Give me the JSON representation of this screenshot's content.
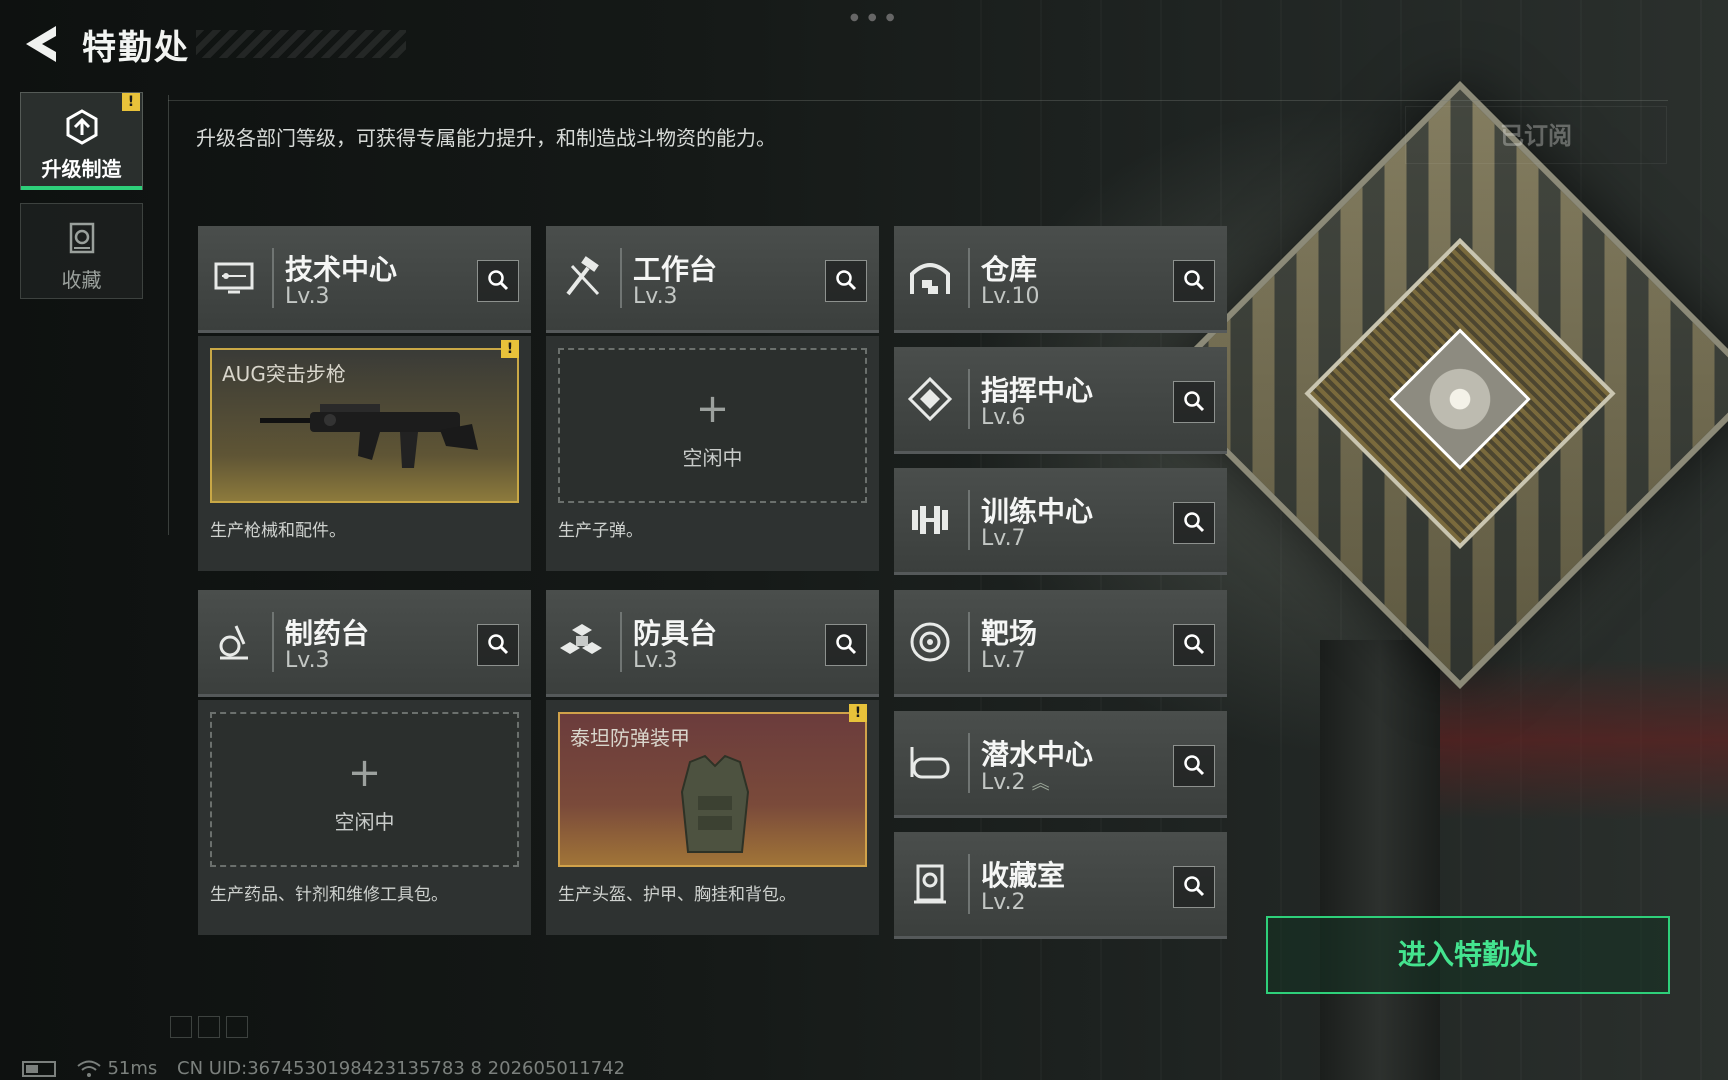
{
  "header": {
    "title": "特勤处",
    "back_icon": "back-arrow-icon"
  },
  "nav": {
    "items": [
      {
        "label": "升级制造",
        "icon": "upgrade-icon",
        "active": true,
        "warning": "!"
      },
      {
        "label": "收藏",
        "icon": "collection-icon",
        "active": false
      }
    ]
  },
  "description": "升级各部门等级，可获得专属能力提升，和制造战斗物资的能力。",
  "subscribe_label": "已订阅",
  "facilities": [
    {
      "name": "技术中心",
      "level": "Lv.3",
      "icon": "tech-center-icon",
      "production": {
        "state": "active",
        "item": "AUG突击步枪",
        "warning": "!"
      },
      "desc": "生产枪械和配件。"
    },
    {
      "name": "工作台",
      "level": "Lv.3",
      "icon": "workbench-icon",
      "production": {
        "state": "idle",
        "idle_label": "空闲中"
      },
      "desc": "生产子弹。"
    },
    {
      "name": "仓库",
      "level": "Lv.10",
      "icon": "warehouse-icon"
    },
    {
      "name": "指挥中心",
      "level": "Lv.6",
      "icon": "command-center-icon"
    },
    {
      "name": "训练中心",
      "level": "Lv.7",
      "icon": "training-center-icon"
    },
    {
      "name": "制药台",
      "level": "Lv.3",
      "icon": "pharmacy-icon",
      "production": {
        "state": "idle",
        "idle_label": "空闲中"
      },
      "desc": "生产药品、针剂和维修工具包。"
    },
    {
      "name": "防具台",
      "level": "Lv.3",
      "icon": "armor-bench-icon",
      "production": {
        "state": "active",
        "item": "泰坦防弹装甲",
        "warning": "!"
      },
      "desc": "生产头盔、护甲、胸挂和背包。"
    },
    {
      "name": "靶场",
      "level": "Lv.7",
      "icon": "shooting-range-icon"
    },
    {
      "name": "潜水中心",
      "level": "Lv.2",
      "icon": "diving-center-icon",
      "upgradeable": true
    },
    {
      "name": "收藏室",
      "level": "Lv.2",
      "icon": "collection-room-icon"
    }
  ],
  "enter_button": "进入特勤处",
  "status": {
    "ping": "51ms",
    "uid": "CN UID:3674530198423135783 8 202605011742"
  },
  "colors": {
    "accent_green": "#2ed07a",
    "warning_yellow": "#e8c23a",
    "gold_border": "#c9a846"
  }
}
